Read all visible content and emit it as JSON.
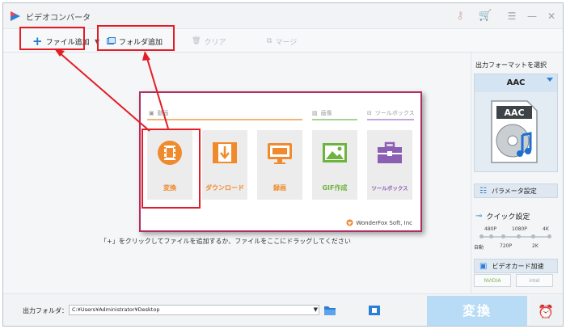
{
  "window": {
    "title": "ビデオコンバータ"
  },
  "titlebar": {
    "icons": [
      "key-icon",
      "cart-icon",
      "menu-icon",
      "minimize-icon",
      "close-icon"
    ]
  },
  "toolbar": {
    "add_file": "ファイル追加",
    "add_folder": "フォルダ追加",
    "clear": "クリア",
    "merge": "マージ"
  },
  "main": {
    "hint": "「+」をクリックしてファイルを追加するか、ファイルをここにドラッグしてください"
  },
  "popup": {
    "categories": [
      "動画",
      "画像",
      "ツールボックス"
    ],
    "tiles": [
      {
        "label": "変換",
        "color": "#f08a2c"
      },
      {
        "label": "ダウンロード",
        "color": "#f08a2c"
      },
      {
        "label": "録画",
        "color": "#f08a2c"
      },
      {
        "label": "GIF作成",
        "color": "#6db33f"
      },
      {
        "label": "ツールボックス",
        "color": "#8b5fb4"
      }
    ],
    "brand": "WonderFox Soft, Inc"
  },
  "side": {
    "title": "出力フォーマットを選択",
    "format": "AAC",
    "format_icon_label": "AAC",
    "param_button": "パラメータ設定",
    "quick_label": "クイック設定",
    "quality_top": [
      "480P",
      "1080P",
      "4K"
    ],
    "quality_bottom": [
      "自動",
      "720P",
      "2K"
    ],
    "gpu_button": "ビデオカード加速",
    "gpu_chips": [
      "NVIDIA",
      "intel"
    ]
  },
  "bottom": {
    "output_label": "出力フォルダ：",
    "output_path": "C:¥Users¥Administrator¥Desktop",
    "convert": "変換"
  },
  "colors": {
    "accent": "#2c7fd6",
    "annotation": "#e21d25",
    "popup_border": "#b02f63"
  }
}
